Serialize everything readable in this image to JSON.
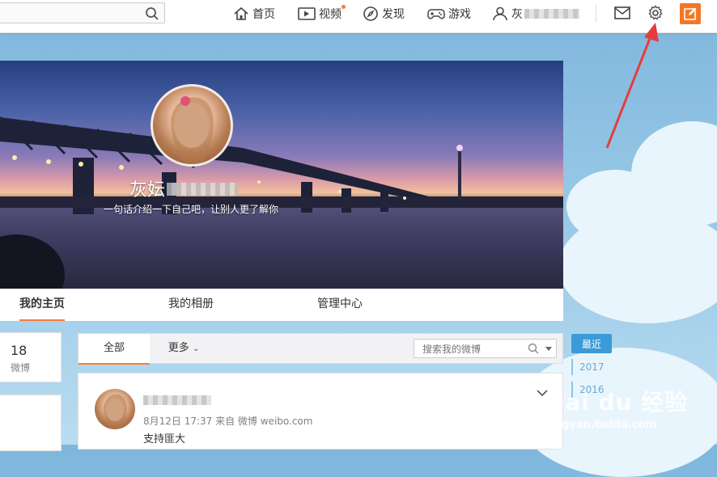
{
  "topbar": {
    "search_placeholder": "",
    "nav": [
      {
        "label": "首页",
        "icon": "home-icon"
      },
      {
        "label": "视频",
        "icon": "video-icon"
      },
      {
        "label": "发现",
        "icon": "compass-icon"
      },
      {
        "label": "游戏",
        "icon": "gamepad-icon"
      },
      {
        "label": "灰",
        "icon": "user-icon"
      }
    ],
    "icons": [
      "mail-icon",
      "gear-icon",
      "compose-icon"
    ],
    "accent": "#f37726"
  },
  "profile": {
    "name": "灰妘",
    "intro": "一句话介绍一下自己吧，让别人更了解你"
  },
  "profile_tabs": [
    "我的主页",
    "我的相册",
    "管理中心"
  ],
  "stats": {
    "count": "18",
    "label": "微博"
  },
  "feed_filter": {
    "tabs": [
      "全部",
      "更多"
    ],
    "search_placeholder": "搜索我的微博"
  },
  "post": {
    "meta": "8月12日 17:37 来自 微博 weibo.com",
    "text": "支持匪大"
  },
  "timeline": {
    "recent": "最近",
    "years": [
      "2017",
      "2016"
    ]
  },
  "watermark": {
    "logo": "Bai du 经验",
    "url": "jingyan.baidu.com"
  }
}
